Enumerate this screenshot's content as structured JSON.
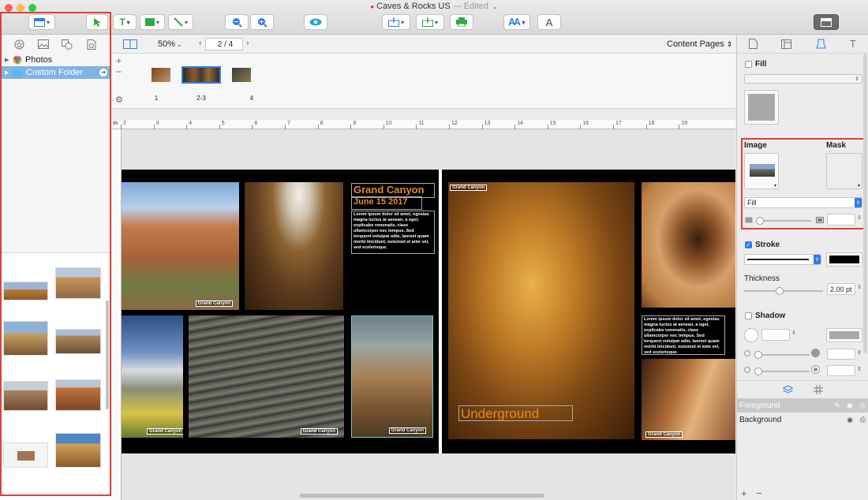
{
  "window": {
    "title": "Caves & Rocks US",
    "edited": "— Edited",
    "traffic_colors": [
      "#fc605c",
      "#fdbc40",
      "#34c84a"
    ]
  },
  "toolbar": {
    "text_tool_label": "T",
    "font_tool_label": "A",
    "accent_color": "#2f7de1"
  },
  "sidebar": {
    "tree": [
      {
        "label": "Photos",
        "icon": "photos-icon"
      },
      {
        "label": "Custom Folder",
        "icon": "folder-icon",
        "selected": true
      }
    ]
  },
  "pagebar": {
    "zoom": "50%",
    "page_field": "2 / 4",
    "view_mode": "Content Pages"
  },
  "thumbnails": [
    {
      "label": "1"
    },
    {
      "label": "2-3"
    },
    {
      "label": "4"
    }
  ],
  "ruler": {
    "unit": "in",
    "ticks": [
      "2",
      "3",
      "4",
      "5",
      "6",
      "7",
      "8",
      "9",
      "10",
      "11",
      "12",
      "13",
      "14",
      "15",
      "16",
      "17",
      "18",
      "19"
    ]
  },
  "spread": {
    "left_title": "Grand Canyon",
    "left_date": "June 15 2017",
    "lorem": "Lorem ipsum dolor sit amet, egestas magna luctus at aenean, a eget, explicabo venenatis, class ullamcorper nec tempus. Sed torquent volutpat odio, laoreet quam morbi tincidunt, euismod et ante vel, sed scelerisque.",
    "caption": "Grand Canyon",
    "underground": "Underground",
    "right_caption": "Grand Canyon"
  },
  "inspector": {
    "fill_label": "Fill",
    "image_label": "Image",
    "mask_label": "Mask",
    "image_mode": "Fill",
    "stroke_label": "Stroke",
    "thickness_label": "Thickness",
    "thickness_value": "2.00 pt",
    "thickness_fraction": 0.45,
    "shadow_label": "Shadow",
    "layers": [
      {
        "label": "Foreground",
        "selected": true
      },
      {
        "label": "Background",
        "selected": false
      }
    ],
    "add_label": "+",
    "remove_label": "−"
  }
}
